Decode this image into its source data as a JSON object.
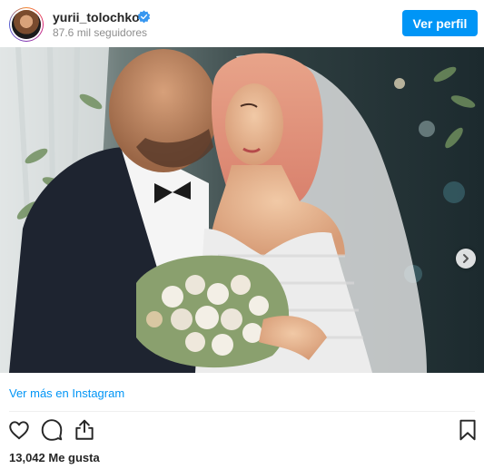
{
  "header": {
    "username": "yurii_tolochko",
    "followers": "87.6 mil seguidores",
    "view_profile_label": "Ver perfil",
    "verified_icon": "verified-badge-icon",
    "accent_color": "#0095f6"
  },
  "post": {
    "image_description_icon": "wedding-photo",
    "carousel_next_icon": "chevron-right-icon"
  },
  "footer": {
    "view_more_link": "Ver más en Instagram",
    "likes": "13,042 Me gusta",
    "actions": {
      "like_icon": "heart-icon",
      "comment_icon": "comment-icon",
      "share_icon": "share-icon",
      "save_icon": "bookmark-icon"
    }
  }
}
